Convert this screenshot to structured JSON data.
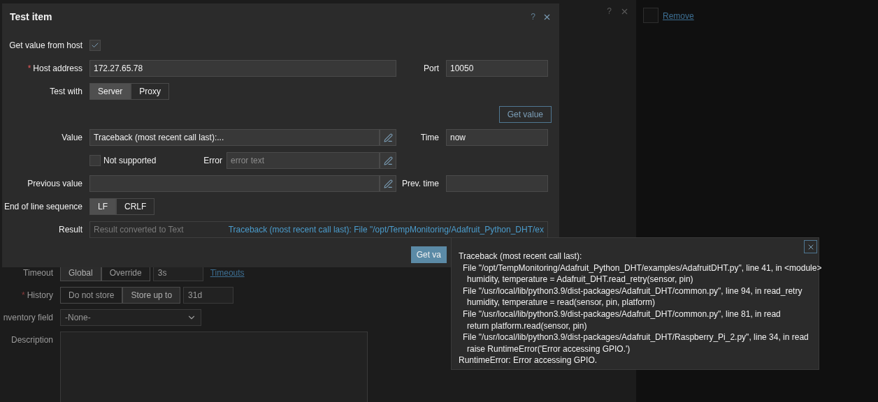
{
  "background_form": {
    "help": "?",
    "rows": [
      {
        "kind": "segmented",
        "label": "Timeout",
        "options": [
          {
            "label": "Global",
            "selected": true
          },
          {
            "label": "Override",
            "selected": false
          }
        ],
        "value": "3s",
        "link": "Timeouts"
      },
      {
        "kind": "segmented",
        "label": "History",
        "required_mark": "*",
        "options": [
          {
            "label": "Do not store",
            "selected": false
          },
          {
            "label": "Store up to",
            "selected": true
          }
        ],
        "value": "31d"
      },
      {
        "kind": "select",
        "label": "nventory field",
        "value": "-None-"
      },
      {
        "kind": "textarea",
        "label": "Description"
      }
    ]
  },
  "side": {
    "checked": false,
    "link": "Remove"
  },
  "modal": {
    "title": "Test item",
    "help": "?",
    "get_value_from_host": {
      "label": "Get value from host",
      "checked": true
    },
    "host_address": {
      "label": "Host address",
      "required_mark": "*",
      "value": "172.27.65.78"
    },
    "port": {
      "label": "Port",
      "value": "10050"
    },
    "test_with": {
      "label": "Test with",
      "options": [
        {
          "label": "Server",
          "selected": true
        },
        {
          "label": "Proxy",
          "selected": false
        }
      ]
    },
    "get_value_button": "Get value",
    "value": {
      "label": "Value",
      "value": "Traceback (most recent call last):..."
    },
    "time": {
      "label": "Time",
      "value": "now"
    },
    "not_supported": {
      "label": "Not supported",
      "checked": false
    },
    "error": {
      "label": "Error",
      "placeholder": "error text"
    },
    "previous_value": {
      "label": "Previous value"
    },
    "prev_time": {
      "label": "Prev. time"
    },
    "eol": {
      "label": "End of line sequence",
      "options": [
        {
          "label": "LF",
          "selected": true
        },
        {
          "label": "CRLF",
          "selected": false
        }
      ]
    },
    "result": {
      "label": "Result",
      "note": "Result converted to Text",
      "value": "Traceback (most recent call last): File \"/opt/TempMonitoring/Adafruit_Python_DHT/ex"
    },
    "submit_button": "Get va"
  },
  "popup": {
    "lines": [
      {
        "kind": "plain",
        "text": "Traceback (most recent call last):"
      },
      {
        "kind": "frame",
        "text": "File \"/opt/TempMonitoring/Adafruit_Python_DHT/examples/AdafruitDHT.py\", line 41, in <module>"
      },
      {
        "kind": "code",
        "text": "humidity, temperature = Adafruit_DHT.read_retry(sensor, pin)"
      },
      {
        "kind": "frame",
        "text": "File \"/usr/local/lib/python3.9/dist-packages/Adafruit_DHT/common.py\", line 94, in read_retry"
      },
      {
        "kind": "code",
        "text": "humidity, temperature = read(sensor, pin, platform)"
      },
      {
        "kind": "frame",
        "text": "File \"/usr/local/lib/python3.9/dist-packages/Adafruit_DHT/common.py\", line 81, in read"
      },
      {
        "kind": "code",
        "text": "return platform.read(sensor, pin)"
      },
      {
        "kind": "frame",
        "text": "File \"/usr/local/lib/python3.9/dist-packages/Adafruit_DHT/Raspberry_Pi_2.py\", line 34, in read"
      },
      {
        "kind": "code",
        "text": "raise RuntimeError('Error accessing GPIO.')"
      },
      {
        "kind": "plain",
        "text": "RuntimeError: Error accessing GPIO."
      }
    ]
  }
}
